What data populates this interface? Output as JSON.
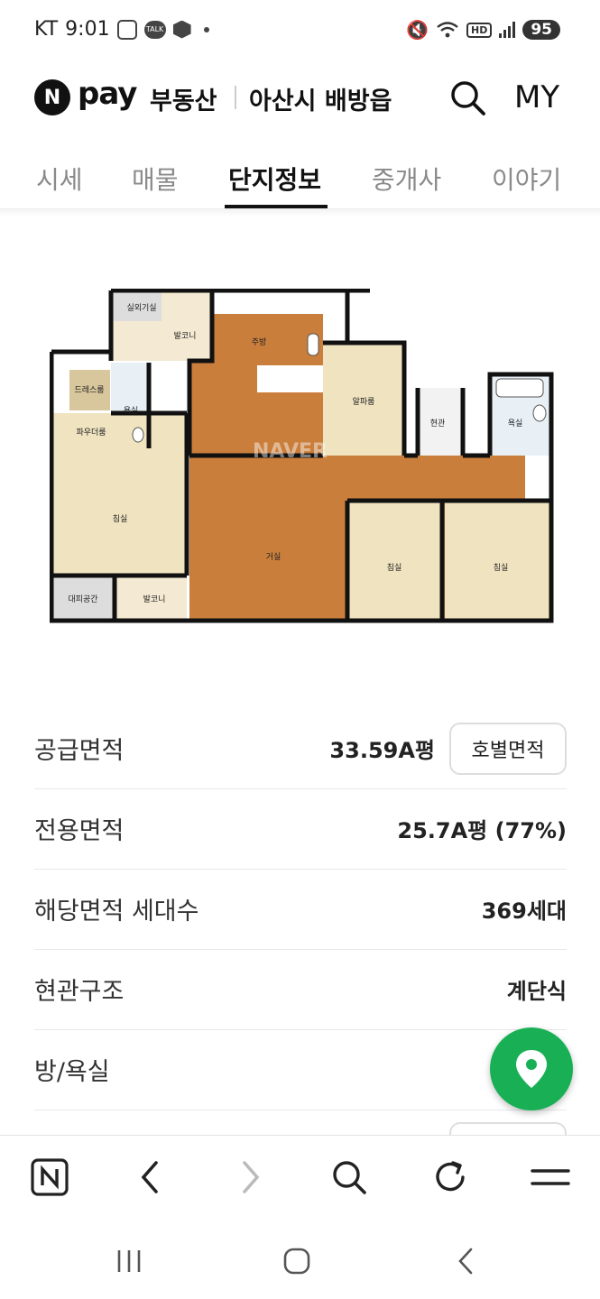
{
  "status_bar": {
    "carrier": "KT",
    "time": "9:01",
    "talk_label": "TALK",
    "hd_label": "HD",
    "battery": "95"
  },
  "header": {
    "logo_letter": "N",
    "logo_text": "pay",
    "service_name": "부동산",
    "region": "아산시 배방읍",
    "my_label": "MY"
  },
  "tabs": [
    {
      "label": "시세",
      "active": false
    },
    {
      "label": "매물",
      "active": false
    },
    {
      "label": "단지정보",
      "active": true
    },
    {
      "label": "중개사",
      "active": false
    },
    {
      "label": "이야기",
      "active": false
    }
  ],
  "floorplan": {
    "watermark": "NAVER",
    "rooms": {
      "outdoor_unit": "실외기실",
      "balcony_top": "발코니",
      "kitchen": "주방",
      "alpha_room": "알파룸",
      "entrance": "현관",
      "bath_right": "욕실",
      "dress_room": "드레스룸",
      "bath_left": "욕실",
      "powder_room": "파우더룸",
      "master_bedroom": "침실",
      "living_room": "거실",
      "bedroom_2": "침실",
      "bedroom_3": "침실",
      "evac_space": "대피공간",
      "balcony_bottom": "발코니"
    }
  },
  "info": {
    "supply_area": {
      "label": "공급면적",
      "value": "33.59A평",
      "button": "호별면적"
    },
    "exclusive_area": {
      "label": "전용면적",
      "value": "25.7A평 (77%)"
    },
    "households": {
      "label": "해당면적 세대수",
      "value": "369세대"
    },
    "entrance_type": {
      "label": "현관구조",
      "value": "계단식"
    },
    "rooms_baths": {
      "label": "방/욕실",
      "value": ""
    }
  },
  "colors": {
    "accent_green": "#19b055",
    "floor_wood": "#c97e3c",
    "room_beige": "#efe3c0"
  },
  "icons": {
    "fab": "location-pin-icon",
    "toolbar": [
      "naver-home-icon",
      "back-arrow-icon",
      "forward-arrow-icon",
      "search-icon",
      "refresh-icon",
      "menu-icon"
    ],
    "system_nav": [
      "recent-apps-icon",
      "home-icon",
      "back-icon"
    ]
  }
}
